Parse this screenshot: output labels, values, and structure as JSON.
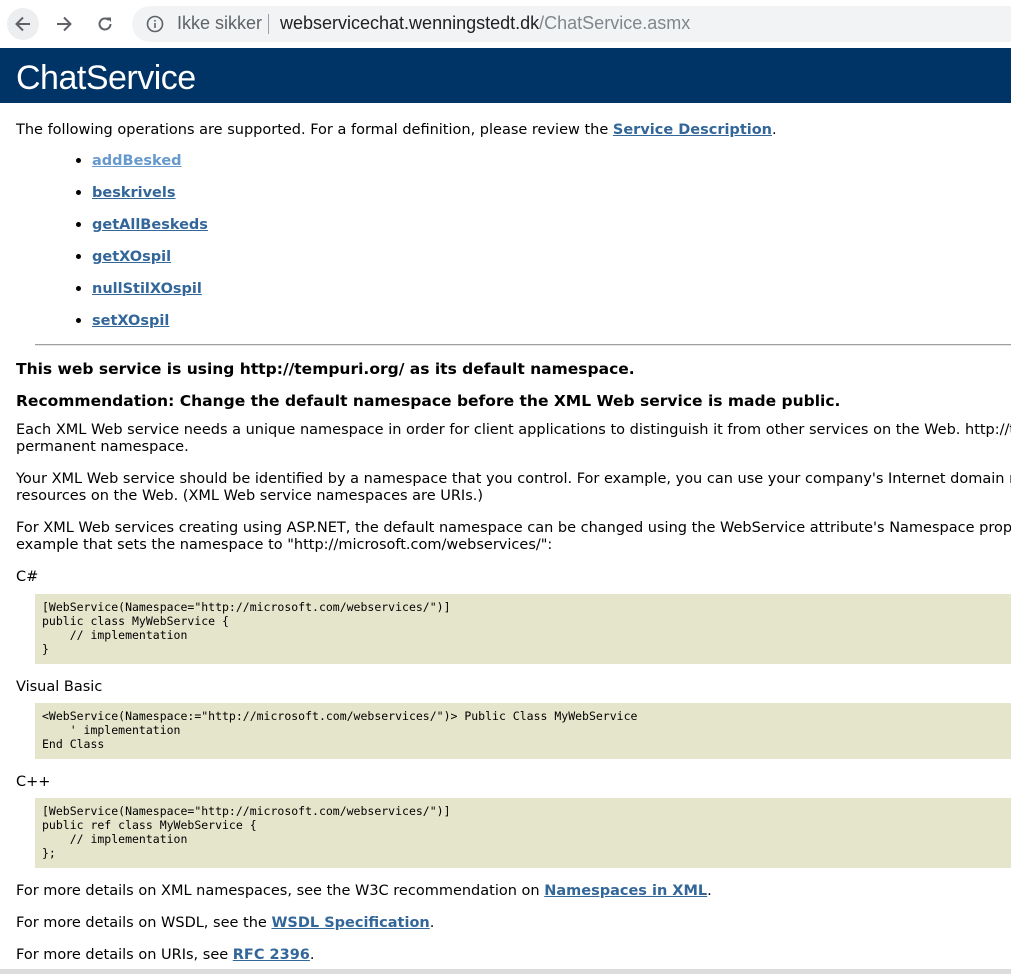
{
  "browser": {
    "security_label": "Ikke sikker",
    "url_host": "webservicechat.wenningstedt.dk",
    "url_path": "/ChatService.asmx"
  },
  "page": {
    "title": "ChatService",
    "intro_text": "The following operations are supported. For a formal definition, please review the ",
    "service_description_link": "Service Description",
    "intro_end": ".",
    "operations": [
      "addBesked",
      "beskrivels",
      "getAllBeskeds",
      "getXOspil",
      "nullStilXOspil",
      "setXOspil"
    ],
    "namespace_heading": "This web service is using http://tempuri.org/ as its default namespace.",
    "recommendation_heading": "Recommendation: Change the default namespace before the XML Web service is made public.",
    "para1_line1": "Each XML Web service needs a unique namespace in order for client applications to distinguish it from other services on the Web. http://tem",
    "para1_line2": "permanent namespace.",
    "para2_line1": "Your XML Web service should be identified by a namespace that you control. For example, you can use your company's Internet domain nam",
    "para2_line2": "resources on the Web. (XML Web service namespaces are URIs.)",
    "para3_line1": "For XML Web services creating using ASP.NET, the default namespace can be changed using the WebService attribute's Namespace property.",
    "para3_line2": "example that sets the namespace to \"http://microsoft.com/webservices/\":",
    "csharp_label": "C#",
    "csharp_code": "[WebService(Namespace=\"http://microsoft.com/webservices/\")]\npublic class MyWebService {\n    // implementation\n}",
    "vb_label": "Visual Basic",
    "vb_code": "<WebService(Namespace:=\"http://microsoft.com/webservices/\")> Public Class MyWebService\n    ' implementation\nEnd Class",
    "cpp_label": "C++",
    "cpp_code": "[WebService(Namespace=\"http://microsoft.com/webservices/\")]\npublic ref class MyWebService {\n    // implementation\n};",
    "ns_text": "For more details on XML namespaces, see the W3C recommendation on ",
    "ns_link": "Namespaces in XML",
    "wsdl_text": "For more details on WSDL, see the ",
    "wsdl_link": "WSDL Specification",
    "uri_text": "For more details on URIs, see ",
    "uri_link": "RFC 2396",
    "period": "."
  },
  "colors": {
    "banner": "#003366",
    "link": "#336699",
    "visited_link": "#6699cc",
    "code_background": "#e5e5cc"
  }
}
